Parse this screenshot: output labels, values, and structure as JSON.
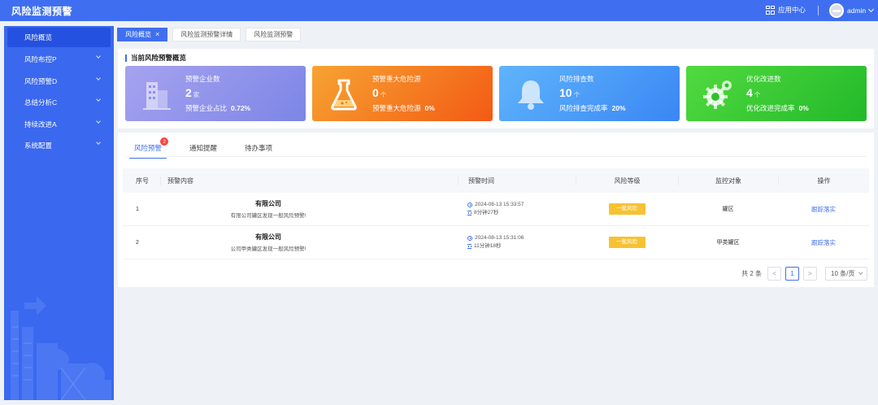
{
  "app": {
    "title": "风险监测预警"
  },
  "header": {
    "app_center": "应用中心",
    "user": "admin"
  },
  "sidebar": {
    "items": [
      {
        "label": "风险概览",
        "active": true
      },
      {
        "label": "风险布控P"
      },
      {
        "label": "风险预警D"
      },
      {
        "label": "总结分析C"
      },
      {
        "label": "持续改进A"
      },
      {
        "label": "系统配置"
      }
    ]
  },
  "tabs": [
    {
      "label": "风险概览",
      "active": true,
      "close": "×"
    },
    {
      "label": "风险监测预警详情"
    },
    {
      "label": "风险监测预警"
    }
  ],
  "overview": {
    "title": "当前风险预警概览",
    "cards": [
      {
        "title": "预警企业数",
        "value": "2",
        "unit": "家",
        "sub_label": "预警企业占比",
        "sub_value": "0.72%",
        "icon": "building-icon"
      },
      {
        "title": "预警重大危险源",
        "value": "0",
        "unit": "个",
        "sub_label": "预警重大危险源",
        "sub_value": "0%",
        "icon": "flask-icon"
      },
      {
        "title": "风险排查数",
        "value": "10",
        "unit": "个",
        "sub_label": "风险排查完成率",
        "sub_value": "20%",
        "icon": "bell-icon"
      },
      {
        "title": "优化改进数",
        "value": "4",
        "unit": "个",
        "sub_label": "优化改进完成率",
        "sub_value": "0%",
        "icon": "gear-icon"
      }
    ]
  },
  "panel": {
    "tabs": [
      {
        "label": "风险预警",
        "badge": "2",
        "active": true
      },
      {
        "label": "通知提醒"
      },
      {
        "label": "待办事项"
      }
    ],
    "columns": {
      "idx": "序号",
      "content": "预警内容",
      "time": "预警时间",
      "level": "风险等级",
      "target": "监控对象",
      "op": "操作"
    },
    "rows": [
      {
        "idx": "1",
        "company": "有限公司",
        "desc": "有限公司罐区发现一般风险预警!",
        "time": "2024-08-13 15:33:57",
        "duration": "8分钟27秒",
        "level": "一般风险",
        "target": "罐区",
        "op": "跟踪落实"
      },
      {
        "idx": "2",
        "company": "有限公司",
        "desc": "公司甲类罐区发现一般风险预警!",
        "time": "2024-08-13 15:31:06",
        "duration": "11分钟18秒",
        "level": "一般风险",
        "target": "甲类罐区",
        "op": "跟踪落实"
      }
    ],
    "pager": {
      "total": "共 2 条",
      "prev": "<",
      "current": "1",
      "next": ">",
      "size": "10 条/页"
    }
  },
  "colors": {
    "primary": "#3f6ff0",
    "warning_tag": "#f7c232",
    "badge": "#f5463e"
  }
}
